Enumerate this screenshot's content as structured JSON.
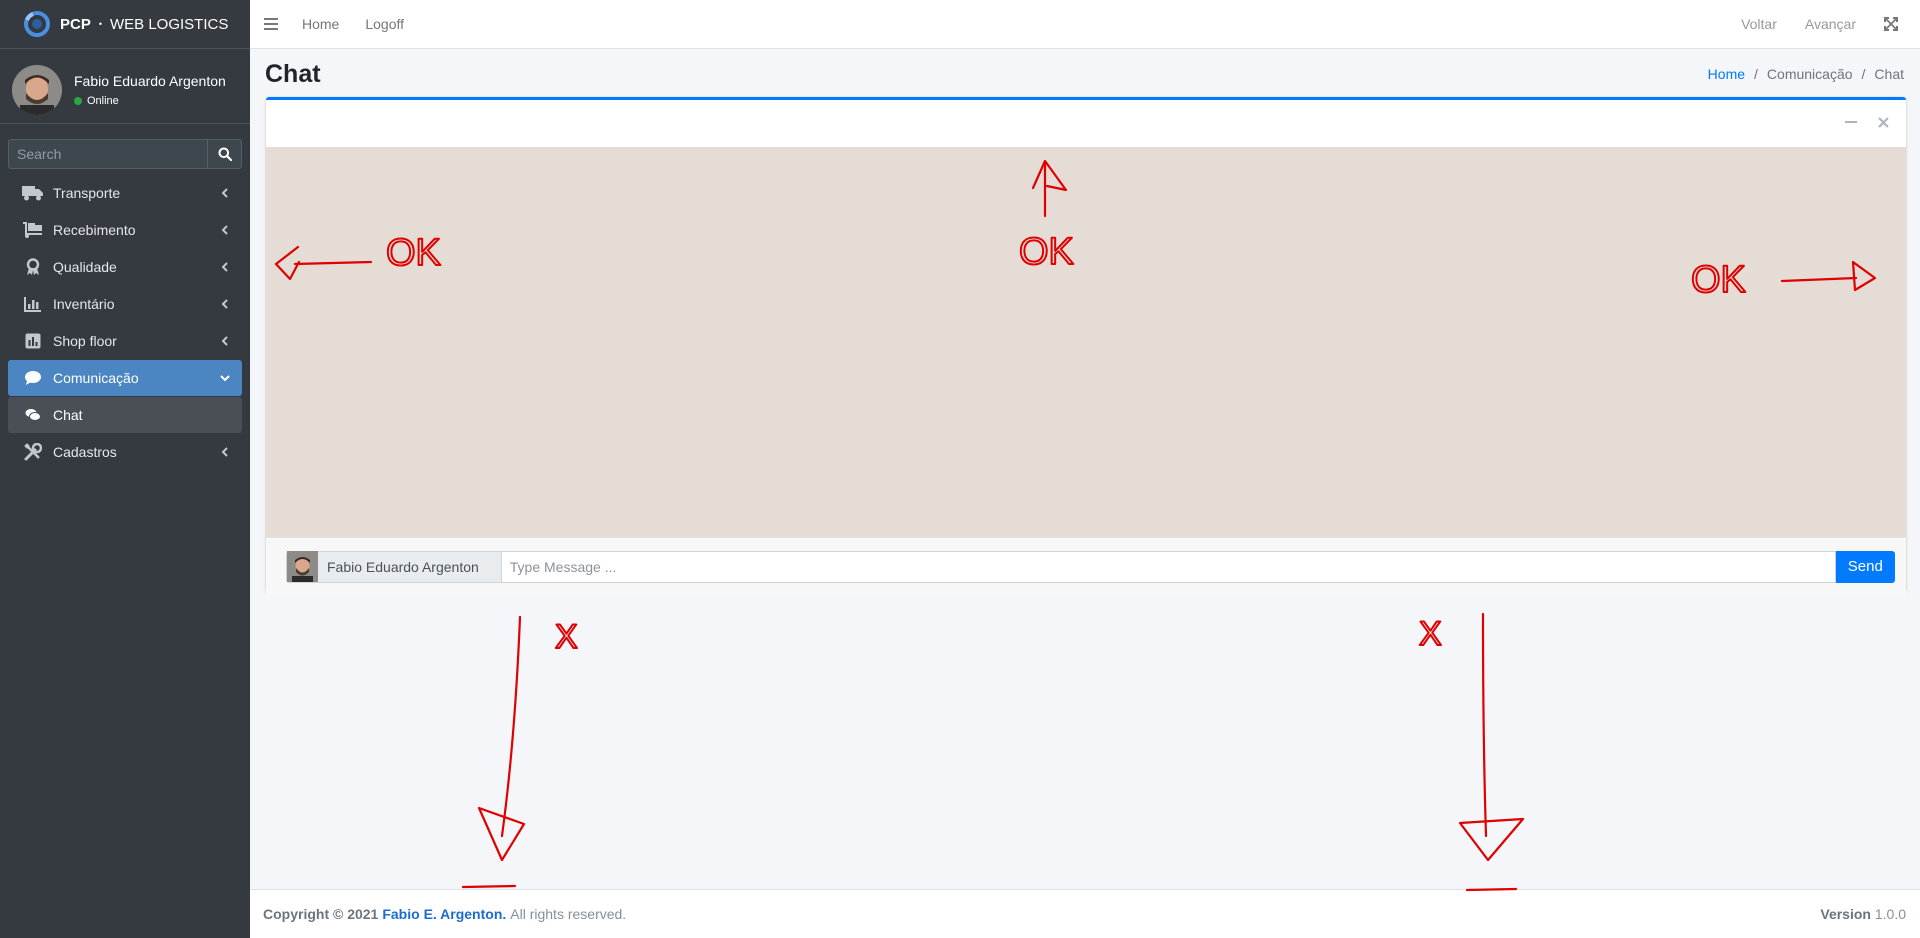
{
  "brand": {
    "name": "PCP",
    "separator": "•",
    "subtitle": "WEB LOGISTICS"
  },
  "user": {
    "name": "Fabio Eduardo Argenton",
    "status": "Online"
  },
  "search": {
    "placeholder": "Search"
  },
  "sidebar": {
    "items": [
      {
        "label": "Transporte",
        "icon": "truck-icon"
      },
      {
        "label": "Recebimento",
        "icon": "dolly-icon"
      },
      {
        "label": "Qualidade",
        "icon": "award-icon"
      },
      {
        "label": "Inventário",
        "icon": "chart-bar-icon"
      },
      {
        "label": "Shop floor",
        "icon": "chart-square-icon"
      },
      {
        "label": "Comunicação",
        "icon": "comment-icon"
      },
      {
        "label": "Chat",
        "icon": "comments-icon"
      },
      {
        "label": "Cadastros",
        "icon": "tools-icon"
      }
    ]
  },
  "topbar": {
    "home": "Home",
    "logoff": "Logoff",
    "back": "Voltar",
    "forward": "Avançar"
  },
  "header": {
    "title": "Chat",
    "breadcrumb": [
      "Home",
      "Comunicação",
      "Chat"
    ]
  },
  "chat": {
    "sender": "Fabio Eduardo Argenton",
    "input_placeholder": "Type Message ...",
    "send_label": "Send"
  },
  "annotations": {
    "ok_left": "OK",
    "ok_top": "OK",
    "ok_right": "OK",
    "x_left": "X",
    "x_right": "X"
  },
  "footer": {
    "copyright": "Copyright © 2021",
    "author": "Fabio E. Argenton.",
    "rights": "All rights reserved.",
    "version_label": "Version",
    "version": "1.0.0"
  },
  "colors": {
    "sidebar_bg": "#343a40",
    "accent": "#007bff",
    "active_item": "#4b86c2",
    "chat_bg": "#e5ddd5",
    "annotation": "#e00000"
  }
}
